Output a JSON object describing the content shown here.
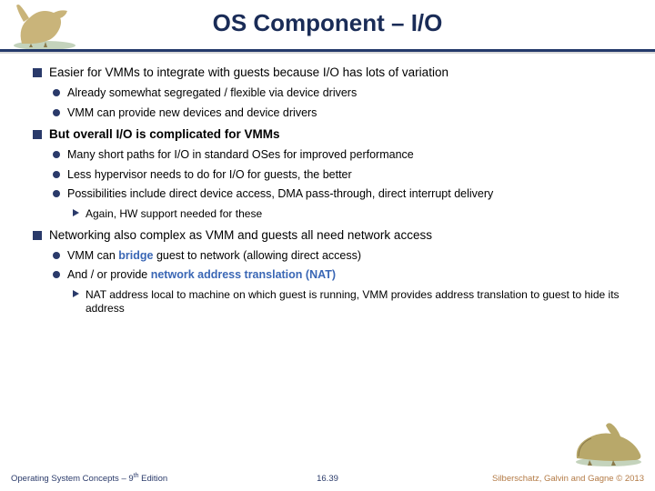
{
  "title": "OS Component – I/O",
  "bullets": {
    "b1": "Easier for VMMs to integrate with guests because I/O has lots of variation",
    "b1a": "Already somewhat segregated / flexible via device drivers",
    "b1b": "VMM can provide new devices and device drivers",
    "b2": "But overall I/O is complicated for VMMs",
    "b2a": "Many short paths for I/O in standard OSes for improved performance",
    "b2b": "Less hypervisor needs to do for I/O for guests, the better",
    "b2c": "Possibilities include direct device access, DMA pass-through, direct interrupt delivery",
    "b2c1": "Again, HW support needed for these",
    "b3": "Networking also complex as VMM and guests all need network access",
    "b3a_pre": "VMM can ",
    "b3a_hl": "bridge",
    "b3a_post": " guest to network (allowing direct access)",
    "b3b_pre": "And / or provide ",
    "b3b_hl": "network address translation (NAT)",
    "b3b1": "NAT address local to machine on which guest is running, VMM provides address translation to guest to hide its address"
  },
  "footer": {
    "left_prefix": "Operating System Concepts – 9",
    "left_sup": "th",
    "left_suffix": " Edition",
    "center": "16.39",
    "right": "Silberschatz, Galvin and Gagne © 2013"
  }
}
